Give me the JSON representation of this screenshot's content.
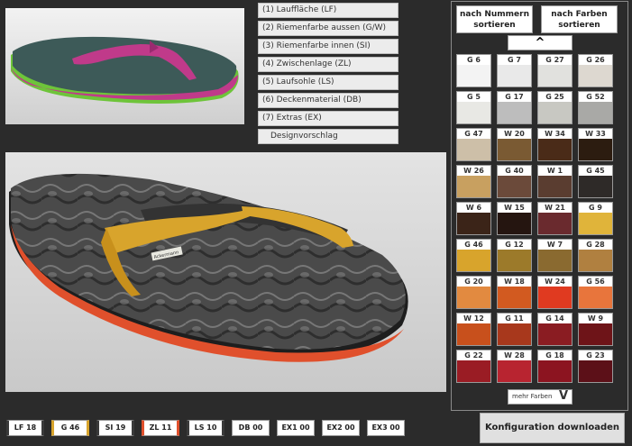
{
  "steps": [
    "(1) Lauffläche (LF)",
    "(2) Riemenfarbe aussen (G/W)",
    "(3) Riemenfarbe innen (SI)",
    "(4) Zwischenlage (ZL)",
    "(5) Laufsohle (LS)",
    "(6) Deckenmaterial (DB)",
    "(7) Extras (EX)",
    "Designvorschlag"
  ],
  "sort": {
    "by_number_line1": "nach Nummern",
    "by_number_line2": "sortieren",
    "by_color_line1": "nach Farben",
    "by_color_line2": "sortieren",
    "up_arrow": "^",
    "more_label": "mehr Farben",
    "more_chevron": "V"
  },
  "swatches": [
    {
      "code": "G 6",
      "color": "#f3f3f3"
    },
    {
      "code": "G 7",
      "color": "#e9e9e9"
    },
    {
      "code": "G 27",
      "color": "#e1e1de"
    },
    {
      "code": "G 26",
      "color": "#ddd8d0"
    },
    {
      "code": "G 5",
      "color": "#e8e8e4"
    },
    {
      "code": "G 17",
      "color": "#bdbdbd"
    },
    {
      "code": "G 25",
      "color": "#c8c8c2"
    },
    {
      "code": "G 52",
      "color": "#a9a9a6"
    },
    {
      "code": "G 47",
      "color": "#cdbfa8"
    },
    {
      "code": "W 20",
      "color": "#7a5a33"
    },
    {
      "code": "W 34",
      "color": "#4a2b18"
    },
    {
      "code": "W 33",
      "color": "#2c1c10"
    },
    {
      "code": "W 26",
      "color": "#c8a060"
    },
    {
      "code": "G 40",
      "color": "#6b4a3a"
    },
    {
      "code": "W 1",
      "color": "#5a3d30"
    },
    {
      "code": "G 45",
      "color": "#2e2a28"
    },
    {
      "code": "W 6",
      "color": "#3b2418"
    },
    {
      "code": "W 15",
      "color": "#251510"
    },
    {
      "code": "W 21",
      "color": "#6a2a2e"
    },
    {
      "code": "G 9",
      "color": "#e0b43a"
    },
    {
      "code": "G 46",
      "color": "#d8a42c"
    },
    {
      "code": "G 12",
      "color": "#9c7a2a"
    },
    {
      "code": "W 7",
      "color": "#8a6a30"
    },
    {
      "code": "G 28",
      "color": "#b08040"
    },
    {
      "code": "G 20",
      "color": "#e28a40"
    },
    {
      "code": "W 18",
      "color": "#d25a20"
    },
    {
      "code": "W 24",
      "color": "#e03a20"
    },
    {
      "code": "G 56",
      "color": "#e8753c"
    },
    {
      "code": "W 12",
      "color": "#c8501c"
    },
    {
      "code": "G 11",
      "color": "#a8381c"
    },
    {
      "code": "G 14",
      "color": "#8a1c22"
    },
    {
      "code": "W 9",
      "color": "#6e1418"
    },
    {
      "code": "G 22",
      "color": "#9a1c24"
    },
    {
      "code": "W 28",
      "color": "#b82430"
    },
    {
      "code": "G 18",
      "color": "#8c1420"
    },
    {
      "code": "G 23",
      "color": "#5c1018"
    }
  ],
  "summary": [
    {
      "label": "LF 18",
      "accent": "#3a3a3a"
    },
    {
      "label": "G 46",
      "accent": "#d8a42c"
    },
    {
      "label": "SI 19",
      "accent": "#3a3a3a"
    },
    {
      "label": "ZL 11",
      "accent": "#e0502c"
    },
    {
      "label": "LS 10",
      "accent": "#3a3a3a"
    },
    {
      "label": "DB 00",
      "accent": ""
    },
    {
      "label": "EX1 00",
      "accent": ""
    },
    {
      "label": "EX2 00",
      "accent": ""
    },
    {
      "label": "EX3 00",
      "accent": ""
    }
  ],
  "download_label": "Konfiguration downloaden",
  "preview_brand": "Ackermann",
  "colors": {
    "preview_sole_top": "#3d5a58",
    "preview_midsole": "#6ec43a",
    "preview_strap": "#c03a8a",
    "main_sole": "#4a4a4a",
    "main_midsole": "#e0502c",
    "main_strap": "#d8a42c"
  }
}
